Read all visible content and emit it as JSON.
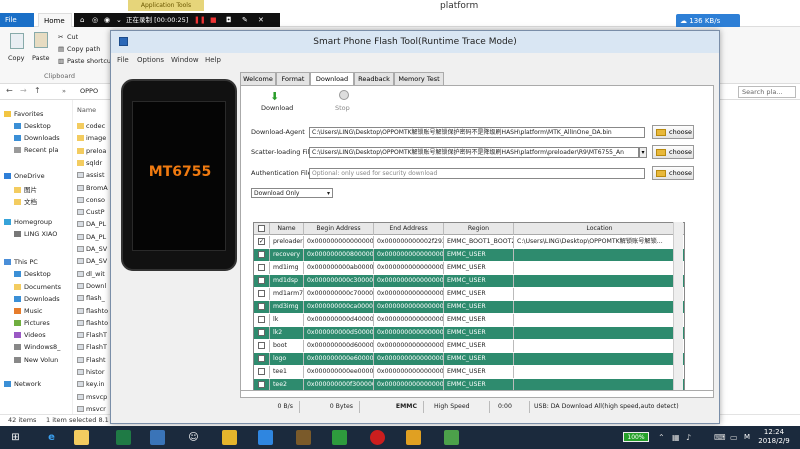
{
  "explorer": {
    "app_tools_label": "Application Tools",
    "window_title": "platform",
    "tabs": [
      "File",
      "Home"
    ],
    "recording": "正在录制 [00:00:25]",
    "speed": "136 KB/s",
    "ribbon": {
      "copy": "Copy",
      "paste": "Paste",
      "cut": "Cut",
      "copy_path": "Copy path",
      "paste_shortcut": "Paste shortcu",
      "clipboard": "Clipboard"
    },
    "address_tail": "OPPO",
    "search_placeholder": "Search pla...",
    "column_header": "Name",
    "nav_items": [
      "Favorites",
      "Desktop",
      "Downloads",
      "Recent pla",
      "OneDrive",
      "图片",
      "文档",
      "Homegroup",
      "LING XIAO",
      "This PC",
      "Desktop",
      "Documents",
      "Downloads",
      "Music",
      "Pictures",
      "Videos",
      "Windows8_",
      "New Volun",
      "Network"
    ],
    "files": [
      "codec",
      "image",
      "preloa",
      "sqldr",
      "assist",
      "BromA",
      "conso",
      "CustP",
      "DA_PL",
      "DA_PL",
      "DA_SV",
      "DA_SV",
      "dl_wit",
      "Downl",
      "flash_",
      "flashto",
      "flashto",
      "FlashT",
      "FlashT",
      "Flasht",
      "histor",
      "key.in",
      "msvcp",
      "msvcr"
    ],
    "status_items": "42 items",
    "status_selected": "1 item selected  8.1"
  },
  "sp_tool": {
    "title": "Smart Phone Flash Tool(Runtime Trace Mode)",
    "menu": [
      "File",
      "Options",
      "Window",
      "Help"
    ],
    "phone_label": "MT6755",
    "tabs": [
      "Welcome",
      "Format",
      "Download",
      "Readback",
      "Memory Test"
    ],
    "active_tab": "Download",
    "download_btn": "Download",
    "stop_btn": "Stop",
    "download_agent_label": "Download-Agent",
    "download_agent_value": "C:\\Users\\LING\\Desktop\\OPPOMTK解锁账号解锁保护密码不是降级刷HASH\\platform\\MTK_AllInOne_DA.bin",
    "scatter_label": "Scatter-loading File",
    "scatter_value": "C:\\Users\\LING\\Desktop\\OPPOMTK解锁账号解锁保护密码不是降级刷HASH\\platform\\preloader\\R9\\MT6755_An",
    "auth_label": "Authentication File",
    "auth_placeholder": "Optional: only used for security download",
    "choose": "choose",
    "mode": "Download Only",
    "columns": [
      "",
      "Name",
      "Begin Address",
      "End Address",
      "Region",
      "Location"
    ],
    "rows": [
      {
        "checked": true,
        "name": "preloader",
        "begin": "0x0000000000000000",
        "end": "0x000000000002f293",
        "region": "EMMC_BOOT1_BOOT2",
        "location": "C:\\Users\\LING\\Desktop\\OPPOMTK解锁账号解锁..."
      },
      {
        "checked": false,
        "name": "recovery",
        "begin": "0x0000000008000000",
        "end": "0x0000000000000000",
        "region": "EMMC_USER",
        "location": ""
      },
      {
        "checked": false,
        "name": "md1img",
        "begin": "0x000000000ab00000",
        "end": "0x0000000000000000",
        "region": "EMMC_USER",
        "location": ""
      },
      {
        "checked": false,
        "name": "md1dsp",
        "begin": "0x000000000c300000",
        "end": "0x0000000000000000",
        "region": "EMMC_USER",
        "location": ""
      },
      {
        "checked": false,
        "name": "md1arm7",
        "begin": "0x000000000c700000",
        "end": "0x0000000000000000",
        "region": "EMMC_USER",
        "location": ""
      },
      {
        "checked": false,
        "name": "md3img",
        "begin": "0x000000000ca00000",
        "end": "0x0000000000000000",
        "region": "EMMC_USER",
        "location": ""
      },
      {
        "checked": false,
        "name": "lk",
        "begin": "0x000000000d400000",
        "end": "0x0000000000000000",
        "region": "EMMC_USER",
        "location": ""
      },
      {
        "checked": false,
        "name": "lk2",
        "begin": "0x000000000d500000",
        "end": "0x0000000000000000",
        "region": "EMMC_USER",
        "location": ""
      },
      {
        "checked": false,
        "name": "boot",
        "begin": "0x000000000d600000",
        "end": "0x0000000000000000",
        "region": "EMMC_USER",
        "location": ""
      },
      {
        "checked": false,
        "name": "logo",
        "begin": "0x000000000e600000",
        "end": "0x0000000000000000",
        "region": "EMMC_USER",
        "location": ""
      },
      {
        "checked": false,
        "name": "tee1",
        "begin": "0x000000000ee00000",
        "end": "0x0000000000000000",
        "region": "EMMC_USER",
        "location": ""
      },
      {
        "checked": false,
        "name": "tee2",
        "begin": "0x000000000f300000",
        "end": "0x0000000000000000",
        "region": "EMMC_USER",
        "location": ""
      }
    ],
    "status": {
      "bps": "0 B/s",
      "bytes": "0 Bytes",
      "storage": "EMMC",
      "speed": "High Speed",
      "time": "0:00",
      "message": "USB: DA Download All(high speed,auto detect)"
    }
  },
  "taskbar": {
    "battery": "100%",
    "time": "12:24",
    "date": "2018/2/9",
    "ime": "M"
  }
}
